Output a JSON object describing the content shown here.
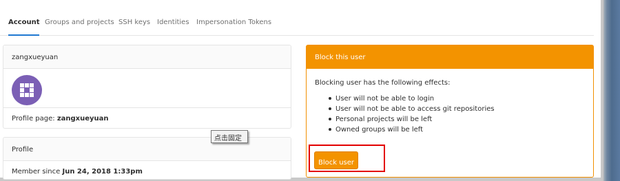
{
  "tabs": [
    {
      "label": "Account",
      "active": true
    },
    {
      "label": "Groups and projects",
      "active": false
    },
    {
      "label": "SSH keys",
      "active": false
    },
    {
      "label": "Identities",
      "active": false
    },
    {
      "label": "Impersonation Tokens",
      "active": false
    }
  ],
  "user_panel": {
    "username": "zangxueyuan",
    "profile_label": "Profile page:",
    "profile_value": "zangxueyuan"
  },
  "profile_panel": {
    "title": "Profile",
    "member_since_label": "Member since",
    "member_since_value": "Jun 24, 2018 1:33pm"
  },
  "tooltip": {
    "text": "点击固定"
  },
  "block_panel": {
    "title": "Block this user",
    "description": "Blocking user has the following effects:",
    "effects": [
      "User will not be able to login",
      "User will not be able to access git repositories",
      "Personal projects will be left",
      "Owned groups will be left"
    ],
    "button_label": "Block user"
  },
  "colors": {
    "accent_orange": "#f39300",
    "highlight_red": "#e30000",
    "avatar_purple": "#7b5fb5",
    "tab_active_underline": "#1f78d1"
  },
  "icons": {
    "avatar": "identicon-grid"
  }
}
